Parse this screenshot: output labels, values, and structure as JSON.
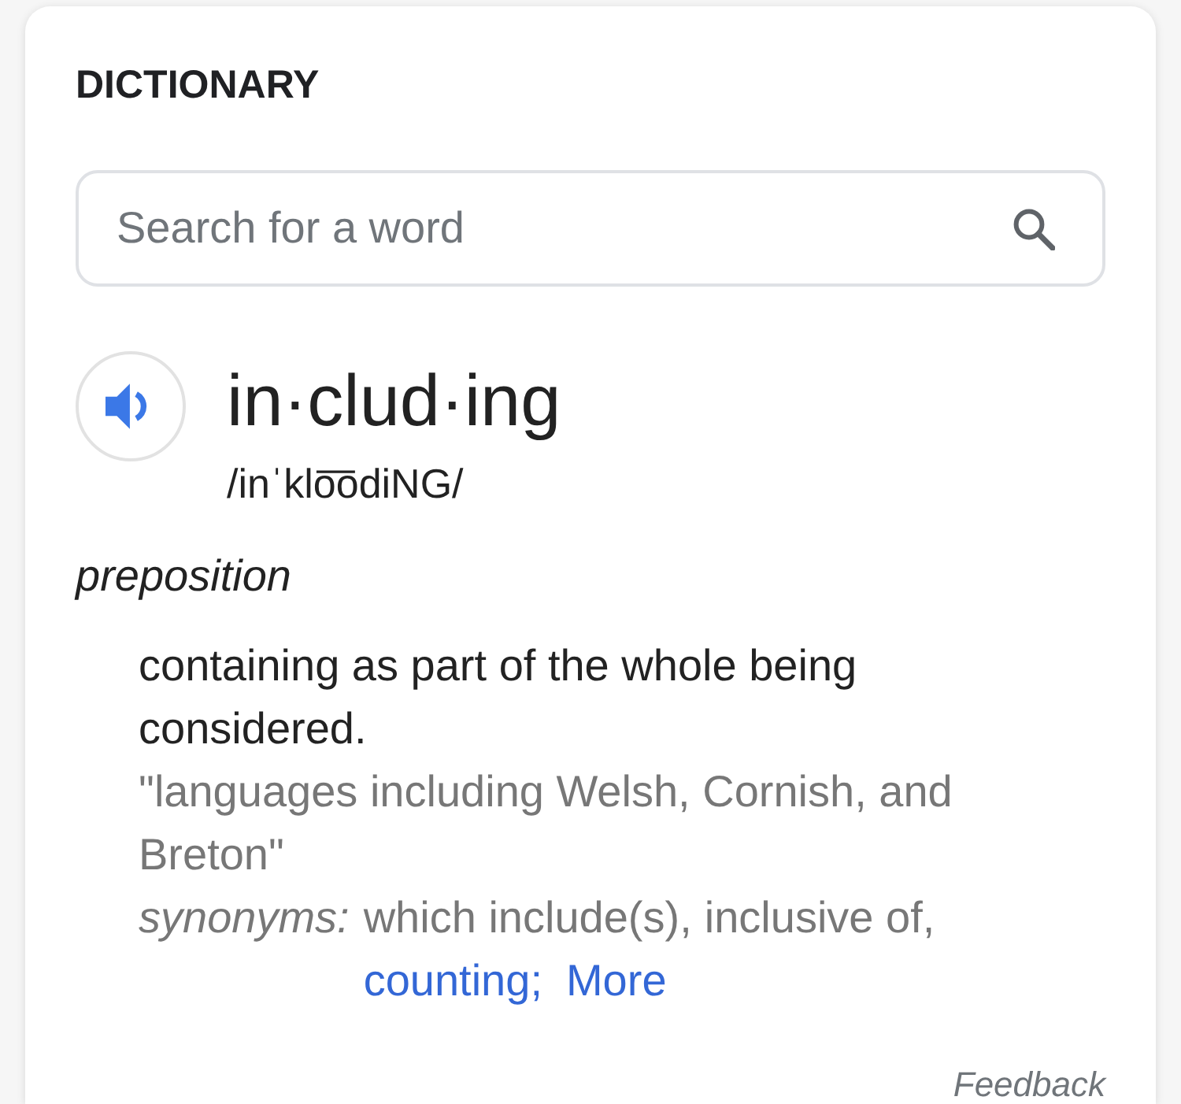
{
  "section_title": "DICTIONARY",
  "search": {
    "placeholder": "Search for a word"
  },
  "entry": {
    "word": "in·clud·ing",
    "pronunciation": "/inˈklo͞odiNG/"
  },
  "senses": [
    {
      "part_of_speech": "preposition",
      "definitions": [
        {
          "text": "containing as part of the whole being considered.",
          "example": "\"languages including Welsh, Cornish, and Breton\"",
          "synonyms_label": "synonyms:",
          "synonyms": [
            {
              "text": "which include(s),",
              "linked": false
            },
            {
              "text": "inclusive of,",
              "linked": false
            },
            {
              "text": "counting;",
              "linked": true
            }
          ],
          "more_link": "More"
        }
      ]
    }
  ],
  "feedback": "Feedback"
}
